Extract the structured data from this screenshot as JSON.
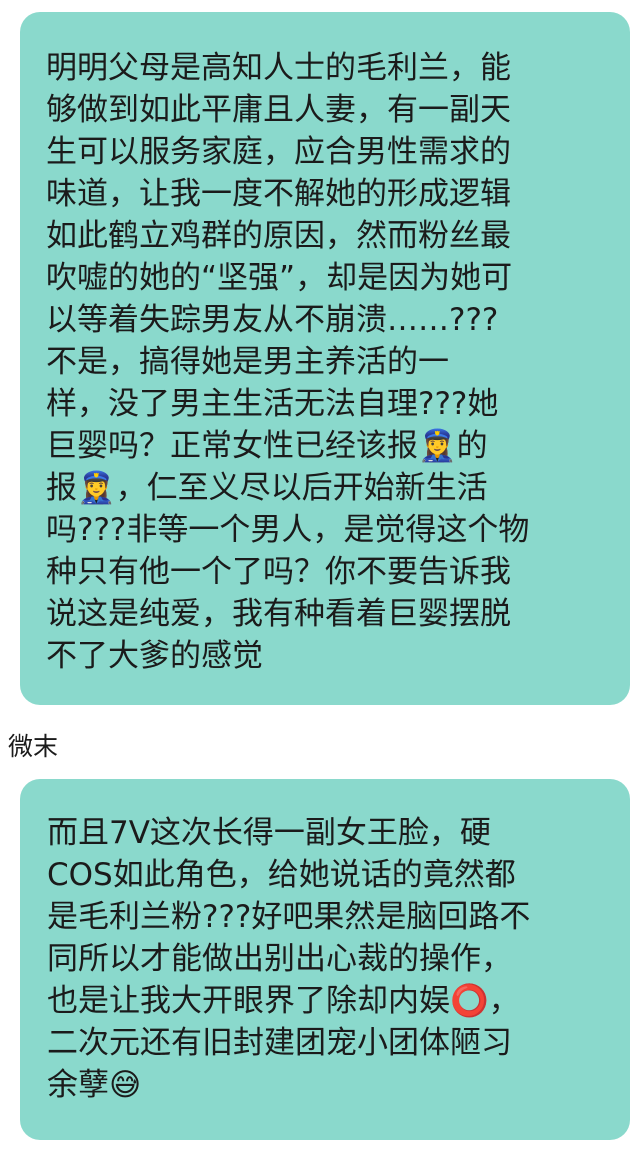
{
  "chat": {
    "messages": [
      {
        "lines": [
          "明明父母是高知人士的毛利兰，能",
          "够做到如此平庸且人妻，有一副天",
          "生可以服务家庭，应合男性需求的",
          "味道，让我一度不解她的形成逻辑",
          "如此鹤立鸡群的原因，然而粉丝最",
          "吹嘘的她的“坚强”，却是因为她可",
          "以等着失踪男友从不崩溃……???",
          "不是，搞得她是男主养活的一",
          "样，没了男主生活无法自理???她",
          "巨婴吗？正常女性已经该报👮‍♀️的",
          "报👮‍♀️，仁至义尽以后开始新生活",
          "吗???非等一个男人，是觉得这个物",
          "种只有他一个了吗？你不要告诉我",
          "说这是纯爱，我有种看着巨婴摆脱",
          "不了大爹的感觉"
        ]
      },
      {
        "sender": "微末",
        "lines": [
          "而且7V这次长得一副女王脸，硬",
          "COS如此角色，给她说话的竟然都",
          "是毛利兰粉???好吧果然是脑回路不",
          "同所以才能做出别出心裁的操作，",
          "也是让我大开眼界了除却内娱⭕️，",
          "二次元还有旧封建团宠小团体陋习",
          "余孽😅"
        ]
      }
    ]
  },
  "colors": {
    "bubble_background": "#8ad9cc",
    "text": "#1b1b1b",
    "page_background": "#ffffff"
  }
}
